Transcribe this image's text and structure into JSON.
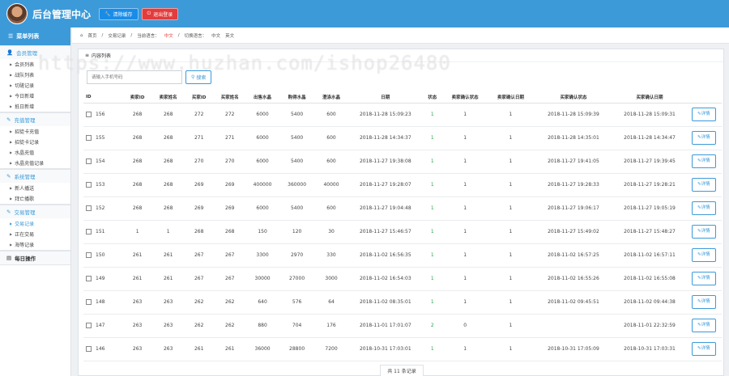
{
  "header": {
    "title": "后台管理中心",
    "btn_clear": "清除缓存",
    "btn_logout": "退出登录",
    "colors": {
      "bar": "#3c9ad9",
      "blue_btn": "#1a8ce8",
      "red_btn": "#e43b3b"
    }
  },
  "sidebar": {
    "menu_title": "菜单列表",
    "groups": [
      {
        "title": "会员管理",
        "items": [
          "会员列表",
          "战队列表",
          "切磋记录",
          "今日新增",
          "抵日新增"
        ]
      },
      {
        "title": "充值管理",
        "items": [
          "招徒卡充值",
          "招徒卡记录",
          "水晶充值",
          "水晶充值记录"
        ]
      },
      {
        "title": "系统管理",
        "items": [
          "新人播送",
          "拜亡播歌"
        ]
      },
      {
        "title": "交易管理",
        "items": [
          "交易记录",
          "正在交易",
          "海等记录"
        ]
      },
      {
        "title": "每日操作",
        "items": []
      }
    ]
  },
  "breadcrumb": {
    "home": "首页",
    "page": "交易记录",
    "lang_label1": "当前语言：",
    "lang_value1": "中文",
    "lang_label2": "切换语言：",
    "lang_cn": "中文",
    "lang_en": "英文"
  },
  "panel": {
    "title": "内容列表",
    "search_placeholder": "请输入手机号码",
    "search_btn": "搜索",
    "columns": [
      "ID",
      "卖家ID",
      "卖家姓名",
      "买家ID",
      "买家姓名",
      "出售水晶",
      "购得水晶",
      "澄涤水晶",
      "日期",
      "状态",
      "卖家确认状态",
      "卖家确认日期",
      "买家确认状态",
      "买家确认日期",
      ""
    ],
    "detail_label": "详情",
    "rows": [
      [
        "156",
        "268",
        "268",
        "272",
        "272",
        "6000",
        "5400",
        "600",
        "2018-11-28 15:09:23",
        "1",
        "1",
        "1",
        "2018-11-28 15:09:39",
        "2018-11-28 15:09:31"
      ],
      [
        "155",
        "268",
        "268",
        "271",
        "271",
        "6000",
        "5400",
        "600",
        "2018-11-28 14:34:37",
        "1",
        "1",
        "1",
        "2018-11-28 14:35:01",
        "2018-11-28 14:34:47"
      ],
      [
        "154",
        "268",
        "268",
        "270",
        "270",
        "6000",
        "5400",
        "600",
        "2018-11-27 19:38:08",
        "1",
        "1",
        "1",
        "2018-11-27 19:41:05",
        "2018-11-27 19:39:45"
      ],
      [
        "153",
        "268",
        "268",
        "269",
        "269",
        "400000",
        "360000",
        "40000",
        "2018-11-27 19:28:07",
        "1",
        "1",
        "1",
        "2018-11-27 19:28:33",
        "2018-11-27 19:28:21"
      ],
      [
        "152",
        "268",
        "268",
        "269",
        "269",
        "6000",
        "5400",
        "600",
        "2018-11-27 19:04:48",
        "1",
        "1",
        "1",
        "2018-11-27 19:06:17",
        "2018-11-27 19:05:19"
      ],
      [
        "151",
        "1",
        "1",
        "268",
        "268",
        "150",
        "120",
        "30",
        "2018-11-27 15:46:57",
        "1",
        "1",
        "1",
        "2018-11-27 15:49:02",
        "2018-11-27 15:48:27"
      ],
      [
        "150",
        "261",
        "261",
        "267",
        "267",
        "3300",
        "2970",
        "330",
        "2018-11-02 16:56:35",
        "1",
        "1",
        "1",
        "2018-11-02 16:57:25",
        "2018-11-02 16:57:11"
      ],
      [
        "149",
        "261",
        "261",
        "267",
        "267",
        "30000",
        "27000",
        "3000",
        "2018-11-02 16:54:03",
        "1",
        "1",
        "1",
        "2018-11-02 16:55:26",
        "2018-11-02 16:55:08"
      ],
      [
        "148",
        "263",
        "263",
        "262",
        "262",
        "640",
        "576",
        "64",
        "2018-11-02 08:35:01",
        "1",
        "1",
        "1",
        "2018-11-02 09:45:51",
        "2018-11-02 09:44:38"
      ],
      [
        "147",
        "263",
        "263",
        "262",
        "262",
        "880",
        "704",
        "176",
        "2018-11-01 17:01:07",
        "2",
        "0",
        "1",
        "",
        "2018-11-01 22:32:59"
      ],
      [
        "146",
        "263",
        "263",
        "261",
        "261",
        "36000",
        "28800",
        "7200",
        "2018-10-31 17:03:01",
        "1",
        "1",
        "1",
        "2018-10-31 17:05:09",
        "2018-10-31 17:03:31"
      ]
    ],
    "total": "共 11 条记录"
  },
  "watermark": "https://www.huzhan.com/ishop26480"
}
